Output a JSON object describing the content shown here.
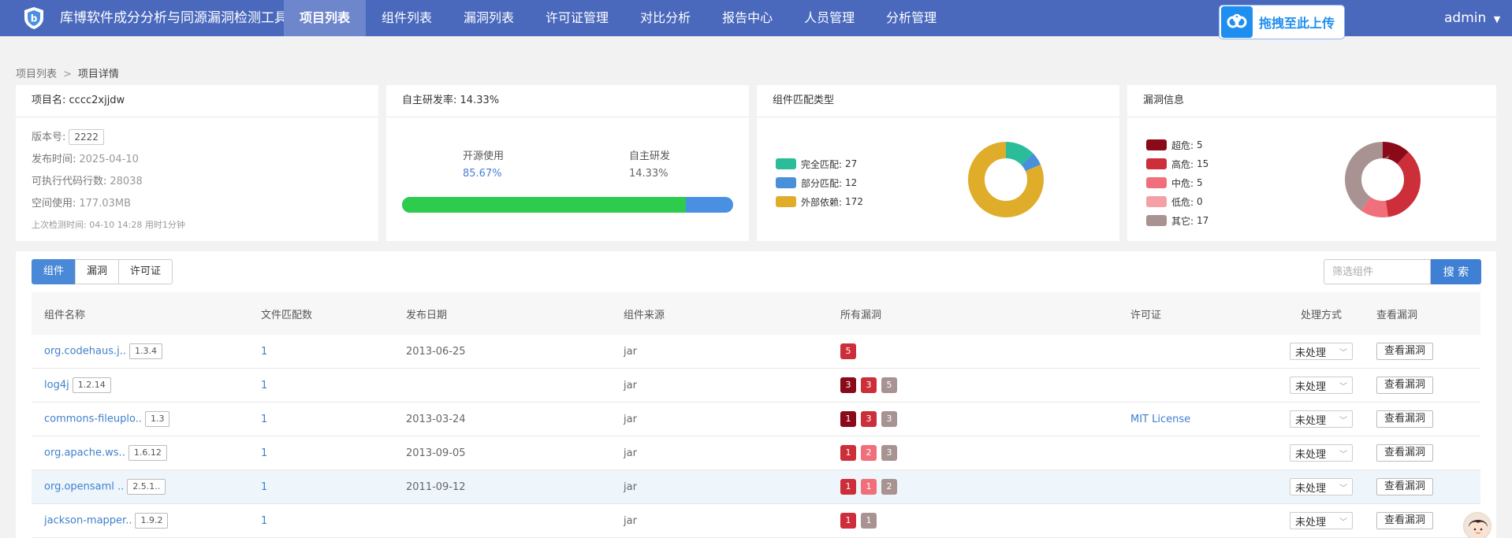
{
  "app": {
    "title": "库博软件成分分析与同源漏洞检测工具",
    "upload_label": "拖拽至此上传",
    "user": "admin"
  },
  "nav": [
    {
      "label": "项目列表",
      "active": true
    },
    {
      "label": "组件列表"
    },
    {
      "label": "漏洞列表"
    },
    {
      "label": "许可证管理"
    },
    {
      "label": "对比分析"
    },
    {
      "label": "报告中心"
    },
    {
      "label": "人员管理"
    },
    {
      "label": "分析管理"
    }
  ],
  "breadcrumb": {
    "root": "项目列表",
    "separator": ">",
    "current": "项目详情"
  },
  "project": {
    "name_label": "项目名:",
    "name": "cccc2xjjdw",
    "version_label": "版本号:",
    "version": "2222",
    "release_label": "发布时间:",
    "release": "2025-04-10",
    "loc_label": "可执行代码行数:",
    "loc": "28038",
    "space_label": "空间使用:",
    "space": "177.03MB",
    "last_scan": "上次检测时间: 04-10 14:28  用时1分钟"
  },
  "dev": {
    "title": "自主研发率:",
    "rate": "14.33%",
    "open_label": "开源使用",
    "open_pct": "85.67%",
    "self_label": "自主研发",
    "self_pct": "14.33%",
    "open_fraction": 0.8567,
    "colors": {
      "open": "#2ecc4e",
      "self": "#4a90e2"
    }
  },
  "match": {
    "title": "组件匹配类型",
    "items": [
      {
        "label": "完全匹配:",
        "value": 27,
        "color": "#2bbd9a"
      },
      {
        "label": "部分匹配:",
        "value": 12,
        "color": "#4a90d9"
      },
      {
        "label": "外部依赖:",
        "value": 172,
        "color": "#e0ad2b"
      }
    ]
  },
  "vuln": {
    "title": "漏洞信息",
    "items": [
      {
        "label": "超危:",
        "value": 5,
        "color": "#8b0a1a"
      },
      {
        "label": "高危:",
        "value": 15,
        "color": "#cc2e3a"
      },
      {
        "label": "中危:",
        "value": 5,
        "color": "#f06f7a"
      },
      {
        "label": "低危:",
        "value": 0,
        "color": "#f5a0a6"
      },
      {
        "label": "其它:",
        "value": 17,
        "color": "#a89292"
      }
    ]
  },
  "tabs": [
    {
      "label": "组件",
      "active": true
    },
    {
      "label": "漏洞"
    },
    {
      "label": "许可证"
    }
  ],
  "search": {
    "placeholder": "筛选组件",
    "button": "搜 索"
  },
  "table": {
    "columns": [
      "组件名称",
      "文件匹配数",
      "发布日期",
      "组件来源",
      "所有漏洞",
      "许可证",
      "处理方式",
      "查看漏洞"
    ],
    "rows": [
      {
        "name": "org.codehaus.j..",
        "version": "1.3.4",
        "files": "1",
        "date": "2013-06-25",
        "source": "jar",
        "vulns": [
          {
            "n": "5",
            "c": "#cc2e3a"
          }
        ],
        "license": "",
        "handle": "未处理",
        "view": "查看漏洞"
      },
      {
        "name": "log4j",
        "version": "1.2.14",
        "files": "1",
        "date": "",
        "source": "jar",
        "vulns": [
          {
            "n": "3",
            "c": "#8b0a1a"
          },
          {
            "n": "3",
            "c": "#cc2e3a"
          },
          {
            "n": "5",
            "c": "#a89292"
          }
        ],
        "license": "",
        "handle": "未处理",
        "view": "查看漏洞"
      },
      {
        "name": "commons-fileuplo..",
        "version": "1.3",
        "files": "1",
        "date": "2013-03-24",
        "source": "jar",
        "vulns": [
          {
            "n": "1",
            "c": "#8b0a1a"
          },
          {
            "n": "3",
            "c": "#cc2e3a"
          },
          {
            "n": "3",
            "c": "#a89292"
          }
        ],
        "license": "MIT License",
        "handle": "未处理",
        "view": "查看漏洞"
      },
      {
        "name": "org.apache.ws..",
        "version": "1.6.12",
        "files": "1",
        "date": "2013-09-05",
        "source": "jar",
        "vulns": [
          {
            "n": "1",
            "c": "#cc2e3a"
          },
          {
            "n": "2",
            "c": "#f06f7a"
          },
          {
            "n": "3",
            "c": "#a89292"
          }
        ],
        "license": "",
        "handle": "未处理",
        "view": "查看漏洞"
      },
      {
        "name": "org.opensaml ..",
        "version": "2.5.1..",
        "files": "1",
        "date": "2011-09-12",
        "source": "jar",
        "vulns": [
          {
            "n": "1",
            "c": "#cc2e3a"
          },
          {
            "n": "1",
            "c": "#f06f7a"
          },
          {
            "n": "2",
            "c": "#a89292"
          }
        ],
        "license": "",
        "handle": "未处理",
        "view": "查看漏洞"
      },
      {
        "name": "jackson-mapper..",
        "version": "1.9.2",
        "files": "1",
        "date": "",
        "source": "jar",
        "vulns": [
          {
            "n": "1",
            "c": "#cc2e3a"
          },
          {
            "n": "1",
            "c": "#a89292"
          }
        ],
        "license": "",
        "handle": "未处理",
        "view": "查看漏洞"
      }
    ]
  }
}
